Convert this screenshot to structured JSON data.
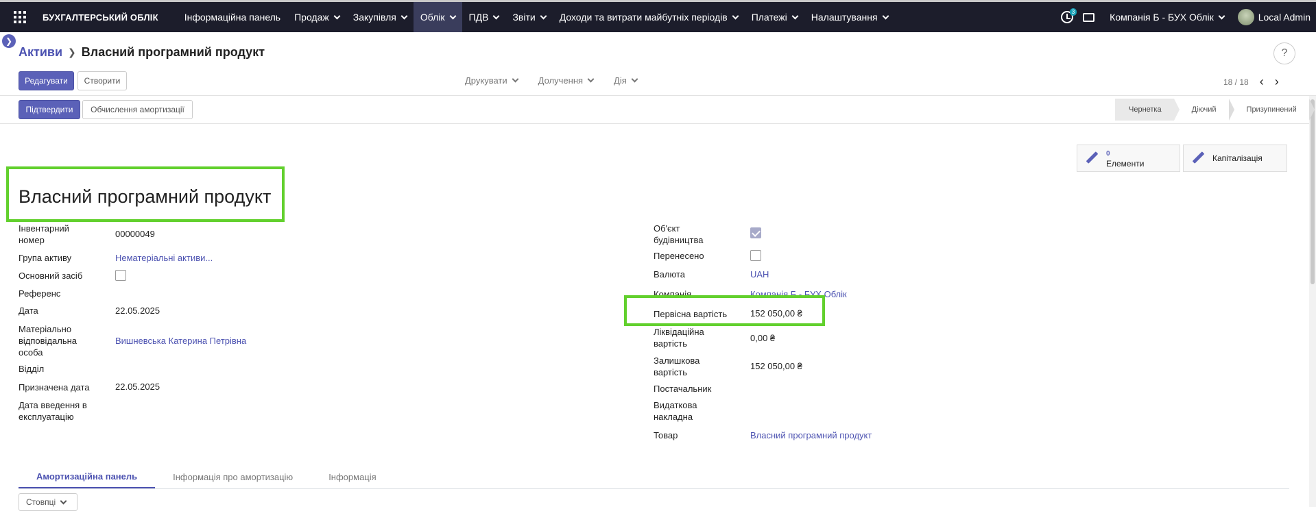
{
  "nav": {
    "brand": "БУХГАЛТЕРСЬКИЙ ОБЛІК",
    "items": [
      {
        "label": "Інформаційна панель",
        "dropdown": false
      },
      {
        "label": "Продаж",
        "dropdown": true
      },
      {
        "label": "Закупівля",
        "dropdown": true
      },
      {
        "label": "Облік",
        "dropdown": true
      },
      {
        "label": "ПДВ",
        "dropdown": true
      },
      {
        "label": "Звіти",
        "dropdown": true
      },
      {
        "label": "Доходи та витрати майбутніх періодів",
        "dropdown": true
      },
      {
        "label": "Платежі",
        "dropdown": true
      },
      {
        "label": "Налаштування",
        "dropdown": true
      }
    ],
    "active_item": "Облік",
    "activity_badge": "3",
    "company": "Компанія Б - БУХ Облік",
    "user": "Local Admin"
  },
  "breadcrumb": {
    "parent": "Активи",
    "current": "Власний програмний продукт"
  },
  "toolbar": {
    "edit": "Редагувати",
    "create": "Створити",
    "print": "Друкувати",
    "attachment": "Долучення",
    "action": "Дія",
    "pager": "18 / 18",
    "help": "?"
  },
  "header_buttons": {
    "confirm": "Підтвердити",
    "compute": "Обчислення амортизації"
  },
  "status": [
    "Чернетка",
    "Діючий",
    "Призупинений"
  ],
  "smart_buttons": {
    "elements_count": "0",
    "elements_label": "Елементи",
    "capitalization_label": "Капіталізація"
  },
  "title": "Власний програмний продукт",
  "left_fields": {
    "inventory_label": "Інвентарний номер",
    "inventory_value": "00000049",
    "group_label": "Група активу",
    "group_value": "Нематеріальні активи...",
    "fixed_asset_label": "Основний засіб",
    "reference_label": "Референс",
    "date_label": "Дата",
    "date_value": "22.05.2025",
    "responsible_label": "Матеріально відповідальна особа",
    "responsible_value": "Вишневська Катерина Петрівна",
    "department_label": "Відділ",
    "assigned_date_label": "Призначена дата",
    "assigned_date_value": "22.05.2025",
    "commission_label": "Дата введення в експлуатацію"
  },
  "right_fields": {
    "construction_label": "Об'єкт будівництва",
    "transferred_label": "Перенесено",
    "currency_label": "Валюта",
    "currency_value": "UAH",
    "company_label": "Компанія",
    "company_value": "Компанія Б - БУХ Облік",
    "initial_cost_label": "Первісна вартість",
    "initial_cost_value": "152 050,00 ₴",
    "salvage_label": "Ліквідаційна вартість",
    "salvage_value": "0,00 ₴",
    "residual_label": "Залишкова вартість",
    "residual_value": "152 050,00 ₴",
    "supplier_label": "Постачальник",
    "invoice_label": "Видаткова накладна",
    "product_label": "Товар",
    "product_value": "Власний програмний продукт"
  },
  "tabs": [
    "Амортизаційна панель",
    "Інформація про амортизацію",
    "Інформація"
  ],
  "columns_button": "Стовпці",
  "colors": {
    "nav_bg": "#1c1d2b",
    "primary": "#5b61b8",
    "link": "#4c52b1",
    "highlight": "#62d02d"
  }
}
